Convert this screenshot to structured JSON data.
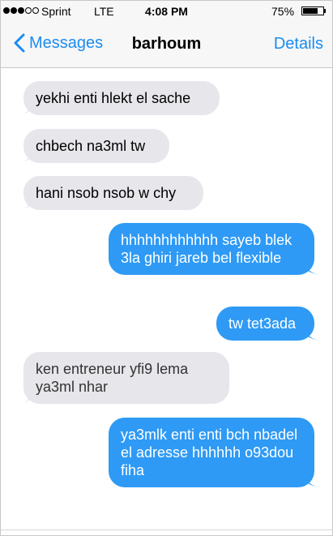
{
  "status_bar": {
    "carrier": "Sprint",
    "network": "LTE",
    "time": "4:08 PM",
    "battery_percent": "75%",
    "battery_level": 0.75,
    "signal_bars_filled": 3,
    "signal_bars_total": 5
  },
  "nav": {
    "back_label": "Messages",
    "contact_name": "barhoum",
    "details_label": "Details"
  },
  "colors": {
    "accent": "#1a8cf0",
    "incoming_bubble": "#e6e6eb",
    "outgoing_bubble": "#2e9af5"
  },
  "messages": [
    {
      "direction": "incoming",
      "text": "yekhi enti hlekt el sache"
    },
    {
      "direction": "incoming",
      "text": "chbech na3ml tw"
    },
    {
      "direction": "incoming",
      "text": "hani nsob nsob w chy"
    },
    {
      "direction": "outgoing",
      "text": "hhhhhhhhhhhh sayeb blek 3la ghiri jareb bel flexible"
    },
    {
      "direction": "outgoing",
      "text": "tw tet3ada"
    },
    {
      "direction": "incoming",
      "text": "ken entreneur yfi9 lema ya3ml nhar"
    },
    {
      "direction": "outgoing",
      "text": "ya3mlk enti enti bch nbadel el adresse hhhhhh o93dou fiha"
    }
  ]
}
